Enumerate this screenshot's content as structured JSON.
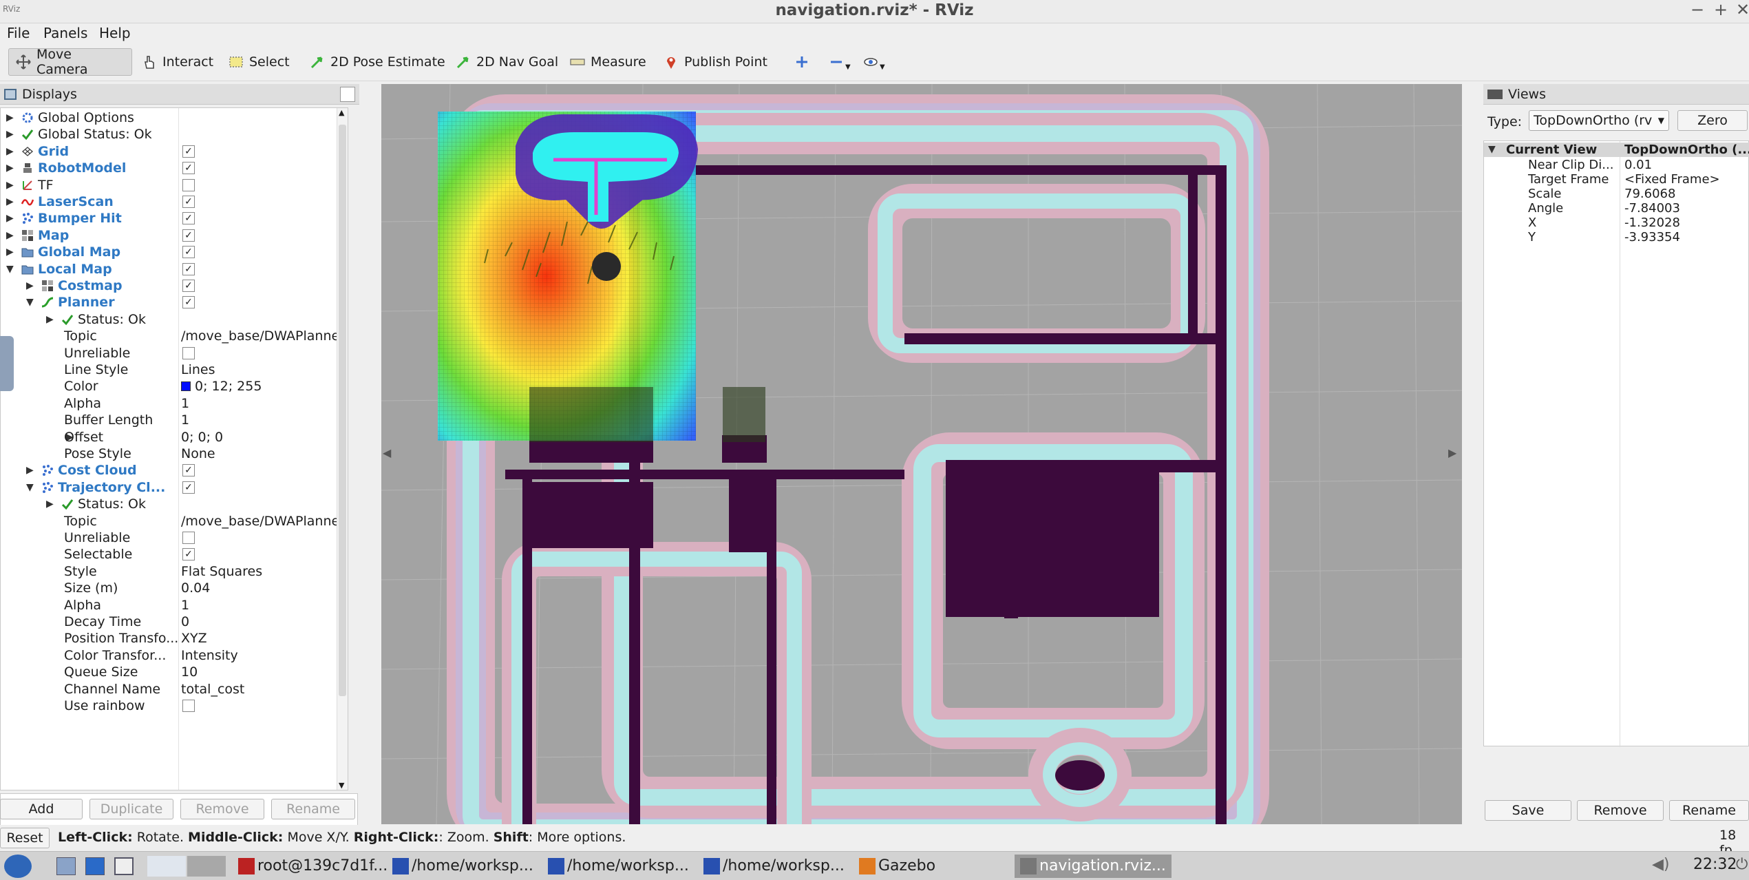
{
  "window": {
    "title": "navigation.rviz* - RViz"
  },
  "menu": [
    "File",
    "Panels",
    "Help"
  ],
  "toolbar": {
    "tools": [
      {
        "label": "Move Camera",
        "icon": "move-camera-icon",
        "active": true
      },
      {
        "label": "Interact",
        "icon": "hand-icon"
      },
      {
        "label": "Select",
        "icon": "select-icon"
      },
      {
        "label": "2D Pose Estimate",
        "icon": "pose-arrow-icon"
      },
      {
        "label": "2D Nav Goal",
        "icon": "goal-arrow-icon"
      },
      {
        "label": "Measure",
        "icon": "ruler-icon"
      },
      {
        "label": "Publish Point",
        "icon": "pin-icon"
      }
    ],
    "add_icon": "plus-icon",
    "remove_icon": "minus-icon",
    "camera_icon": "eye-icon"
  },
  "displays": {
    "title": "Displays",
    "rows": [
      {
        "label": "Global Options",
        "arrow": "▶",
        "icon": "gear"
      },
      {
        "label": "Global Status: Ok",
        "arrow": "▶",
        "icon": "check"
      },
      {
        "label": "Grid",
        "bold": true,
        "checked": true,
        "arrow": "▶",
        "icon": "grid"
      },
      {
        "label": "RobotModel",
        "bold": true,
        "checked": true,
        "arrow": "▶",
        "icon": "robot"
      },
      {
        "label": "TF",
        "checked": false,
        "arrow": "▶",
        "icon": "tf"
      },
      {
        "label": "LaserScan",
        "bold": true,
        "checked": true,
        "arrow": "▶",
        "icon": "laser"
      },
      {
        "label": "Bumper Hit",
        "bold": true,
        "checked": true,
        "arrow": "▶",
        "icon": "points"
      },
      {
        "label": "Map",
        "bold": true,
        "checked": true,
        "arrow": "▶",
        "icon": "map"
      },
      {
        "label": "Global Map",
        "bold": true,
        "checked": true,
        "arrow": "▶",
        "icon": "folder"
      },
      {
        "label": "Local Map",
        "bold": true,
        "checked": true,
        "arrow": "▼",
        "icon": "folder"
      },
      {
        "label": "Costmap",
        "bold": true,
        "checked": true,
        "arrow": "▶",
        "indent": 1,
        "icon": "map"
      },
      {
        "label": "Planner",
        "bold": true,
        "checked": true,
        "arrow": "▼",
        "indent": 1,
        "icon": "path"
      },
      {
        "label": "Status: Ok",
        "arrow": "▶",
        "indent": 2,
        "icon": "check"
      },
      {
        "label": "Topic",
        "value": "/move_base/DWAPlanner...",
        "indent": 3
      },
      {
        "label": "Unreliable",
        "checked": false,
        "indent": 3
      },
      {
        "label": "Line Style",
        "value": "Lines",
        "indent": 3
      },
      {
        "label": "Color",
        "value": "0; 12; 255",
        "swatch": "#000cff",
        "indent": 3
      },
      {
        "label": "Alpha",
        "value": "1",
        "indent": 3
      },
      {
        "label": "Buffer Length",
        "value": "1",
        "indent": 3
      },
      {
        "label": "Offset",
        "value": "0; 0; 0",
        "arrow": "▶",
        "indent": 3
      },
      {
        "label": "Pose Style",
        "value": "None",
        "indent": 3
      },
      {
        "label": "Cost Cloud",
        "bold": true,
        "checked": true,
        "arrow": "▶",
        "indent": 1,
        "icon": "points"
      },
      {
        "label": "Trajectory Cl...",
        "bold": true,
        "checked": true,
        "arrow": "▼",
        "indent": 1,
        "icon": "points"
      },
      {
        "label": "Status: Ok",
        "arrow": "▶",
        "indent": 2,
        "icon": "check"
      },
      {
        "label": "Topic",
        "value": "/move_base/DWAPlanner...",
        "indent": 3
      },
      {
        "label": "Unreliable",
        "checked": false,
        "indent": 3
      },
      {
        "label": "Selectable",
        "checked": true,
        "indent": 3
      },
      {
        "label": "Style",
        "value": "Flat Squares",
        "indent": 3
      },
      {
        "label": "Size (m)",
        "value": "0.04",
        "indent": 3
      },
      {
        "label": "Alpha",
        "value": "1",
        "indent": 3
      },
      {
        "label": "Decay Time",
        "value": "0",
        "indent": 3
      },
      {
        "label": "Position Transfo...",
        "value": "XYZ",
        "indent": 3
      },
      {
        "label": "Color Transfor...",
        "value": "Intensity",
        "indent": 3
      },
      {
        "label": "Queue Size",
        "value": "10",
        "indent": 3
      },
      {
        "label": "Channel Name",
        "value": "total_cost",
        "indent": 3
      },
      {
        "label": "Use rainbow",
        "checked": false,
        "indent": 3
      }
    ],
    "buttons": {
      "add": "Add",
      "duplicate": "Duplicate",
      "remove": "Remove",
      "rename": "Rename"
    }
  },
  "views": {
    "title": "Views",
    "type_label": "Type:",
    "type_value": "TopDownOrtho (rv",
    "zero": "Zero",
    "header": {
      "name": "Current View",
      "value": "TopDownOrtho (..."
    },
    "props": [
      {
        "name": "Near Clip Di...",
        "value": "0.01"
      },
      {
        "name": "Target Frame",
        "value": "<Fixed Frame>"
      },
      {
        "name": "Scale",
        "value": "79.6068"
      },
      {
        "name": "Angle",
        "value": "-7.84003"
      },
      {
        "name": "X",
        "value": "-1.32028"
      },
      {
        "name": "Y",
        "value": "-3.93354"
      }
    ],
    "buttons": {
      "save": "Save",
      "remove": "Remove",
      "rename": "Rename"
    }
  },
  "status": {
    "reset": "Reset",
    "left_click": "Left-Click:",
    "left_desc": " Rotate. ",
    "middle_click": "Middle-Click:",
    "middle_desc": " Move X/Y. ",
    "right_click": "Right-Click:",
    "right_desc": ": Zoom. ",
    "shift": "Shift",
    "shift_desc": ": More options.",
    "fps": "18 fp"
  },
  "taskbar": {
    "tasks": [
      {
        "label": "root@139c7d1f...",
        "icon": "terminal-icon"
      },
      {
        "label": "/home/worksp...",
        "icon": "editor-icon"
      },
      {
        "label": "/home/worksp...",
        "icon": "editor-icon"
      },
      {
        "label": "/home/worksp...",
        "icon": "editor-icon"
      },
      {
        "label": "Gazebo",
        "icon": "gazebo-icon"
      },
      {
        "label": "navigation.rviz...",
        "icon": "rviz-icon",
        "active": true
      }
    ],
    "clock": "22:32"
  }
}
